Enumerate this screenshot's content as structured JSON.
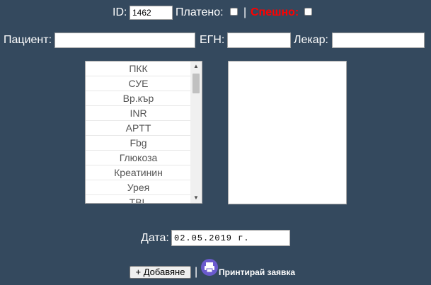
{
  "header": {
    "id_label": "ID:",
    "id_value": "1462",
    "paid_label": "Платено:",
    "separator": "|",
    "urgent_label": "Спешно:",
    "urgent_color": "#ff0000"
  },
  "patient": {
    "patient_label": "Пациент:",
    "patient_value": "",
    "egn_label": "ЕГН:",
    "egn_value": "",
    "doctor_label": "Лекар:",
    "doctor_value": ""
  },
  "tests": {
    "items": [
      "ПКК",
      "СУЕ",
      "Вр.кър",
      "INR",
      "APTT",
      "Fbg",
      "Глюкоза",
      "Креатинин",
      "Урея",
      "TBL"
    ],
    "selected": []
  },
  "date": {
    "label": "Дата:",
    "value": "02.05.2019 г."
  },
  "actions": {
    "add_label": "+ Добавяне",
    "separator": "|",
    "print_label": "Принтирай заявка",
    "print_icon": "printer-icon",
    "print_icon_color": "#6a5acd"
  },
  "colors": {
    "background": "#34495e",
    "text": "#ffffff"
  }
}
